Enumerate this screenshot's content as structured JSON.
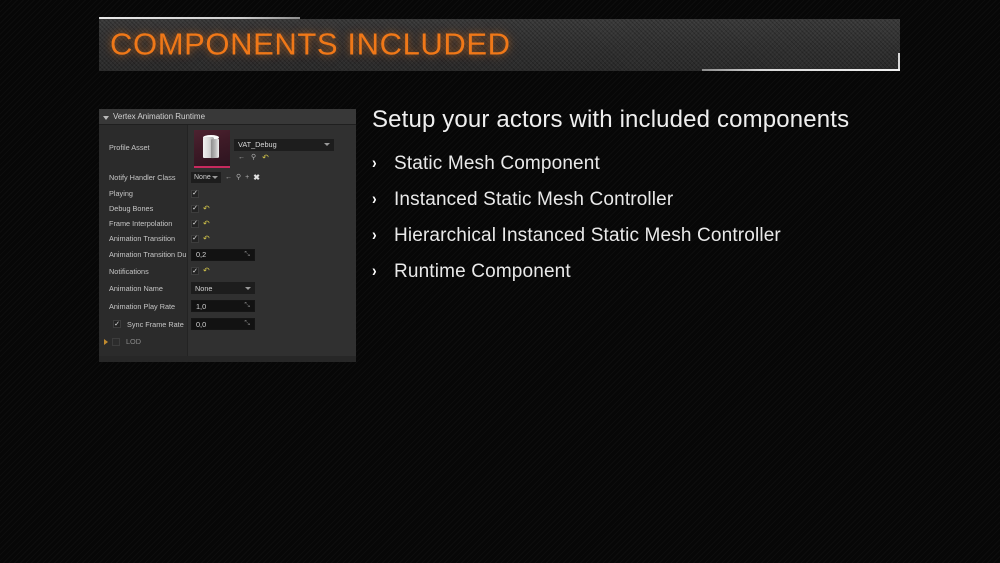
{
  "slide": {
    "title": "COMPONENTS INCLUDED",
    "accent_color": "#F07818",
    "background_color": "#070707",
    "banner_color": "#333333"
  },
  "body": {
    "lead": "Setup your actors with included components",
    "bullet_glyph": "›",
    "bullets": [
      {
        "label": "Static Mesh Component"
      },
      {
        "label": "Instanced Static Mesh Controller"
      },
      {
        "label": "Hierarchical Instanced Static Mesh Controller"
      },
      {
        "label": "Runtime Component"
      }
    ]
  },
  "details_panel": {
    "header": "Vertex Animation Runtime",
    "rows": {
      "profile_asset": {
        "label": "Profile Asset",
        "value": "VAT_Debug",
        "icons": [
          "browse-icon",
          "search-icon",
          "reset-icon"
        ],
        "browse_glyph": "←",
        "search_glyph": "⚲",
        "reset_glyph": "↶"
      },
      "notify_handler_class": {
        "label": "Notify Handler Class",
        "value": "None",
        "browse_glyph": "←",
        "search_glyph": "⚲",
        "add_glyph": "+",
        "clear_glyph": "✖"
      },
      "playing": {
        "label": "Playing",
        "checked": true,
        "check_glyph": "✓"
      },
      "debug_bones": {
        "label": "Debug Bones",
        "checked": true,
        "check_glyph": "✓",
        "reset_glyph": "↶"
      },
      "frame_interpolation": {
        "label": "Frame Interpolation",
        "checked": true,
        "check_glyph": "✓",
        "reset_glyph": "↶"
      },
      "animation_transition": {
        "label": "Animation Transition",
        "checked": true,
        "check_glyph": "✓",
        "reset_glyph": "↶"
      },
      "animation_transition_duration": {
        "label": "Animation Transition Durati",
        "value": "0,2",
        "spin_glyph": "⤡"
      },
      "notifications": {
        "label": "Notifications",
        "checked": true,
        "check_glyph": "✓",
        "reset_glyph": "↶"
      },
      "animation_name": {
        "label": "Animation Name",
        "value": "None"
      },
      "animation_play_rate": {
        "label": "Animation Play Rate",
        "value": "1,0",
        "spin_glyph": "⤡"
      },
      "sync_frame_rate": {
        "label": "Sync Frame Rate",
        "checked": true,
        "check_glyph": "✓",
        "value": "0,0",
        "spin_glyph": "⤡"
      },
      "lod": {
        "label": "LOD",
        "checked": false
      }
    }
  }
}
